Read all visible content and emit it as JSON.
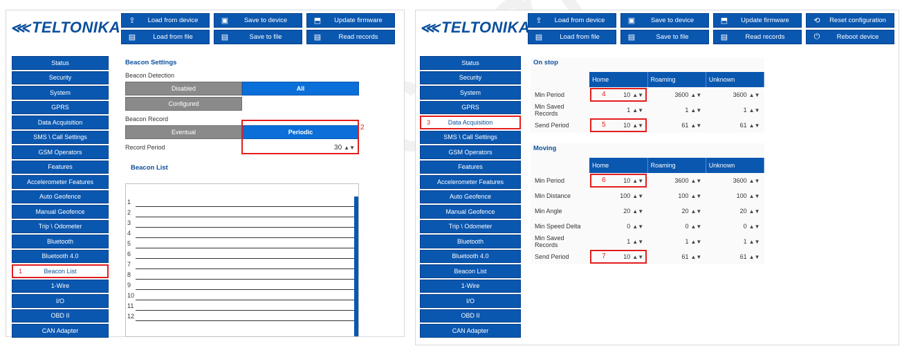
{
  "watermark": "430.com",
  "left": {
    "logo": "TELTONIKA",
    "toolbar": [
      {
        "label": "Load from device",
        "icon": "upload-icon"
      },
      {
        "label": "Save to device",
        "icon": "save-icon"
      },
      {
        "label": "Update firmware",
        "icon": "firmware-icon"
      },
      {
        "label": "Load from file",
        "icon": "file-icon"
      },
      {
        "label": "Save to file",
        "icon": "file-icon"
      },
      {
        "label": "Read records",
        "icon": "file-icon"
      }
    ],
    "sidebar": [
      "Status",
      "Security",
      "System",
      "GPRS",
      "Data Acquisition",
      "SMS \\ Call Settings",
      "GSM Operators",
      "Features",
      "Accelerometer Features",
      "Auto Geofence",
      "Manual Geofence",
      "Trip \\ Odometer",
      "Bluetooth",
      "Bluetooth 4.0",
      "Beacon List",
      "1-Wire",
      "I/O",
      "OBD II",
      "CAN Adapter"
    ],
    "active_item": "Beacon List",
    "active_number": "1",
    "beacon_settings": {
      "title": "Beacon Settings",
      "detection_label": "Beacon Detection",
      "opt_disabled": "Disabled",
      "opt_all": "All",
      "opt_configured": "Configured",
      "record_label": "Beacon Record",
      "opt_eventual": "Eventual",
      "opt_periodic": "Periodic",
      "period_label": "Record Period",
      "period_value": "30",
      "annotation": "2"
    },
    "beacon_list": {
      "title": "Beacon List",
      "rows": [
        "1",
        "2",
        "3",
        "4",
        "5",
        "6",
        "7",
        "8",
        "9",
        "10",
        "11",
        "12"
      ]
    }
  },
  "right": {
    "logo": "TELTONIKA",
    "toolbar": [
      {
        "label": "Load from device",
        "icon": "upload-icon"
      },
      {
        "label": "Save to device",
        "icon": "save-icon"
      },
      {
        "label": "Update firmware",
        "icon": "firmware-icon"
      },
      {
        "label": "Reset configuration",
        "icon": "reset-icon"
      },
      {
        "label": "Load from file",
        "icon": "file-icon"
      },
      {
        "label": "Save to file",
        "icon": "file-icon"
      },
      {
        "label": "Read records",
        "icon": "file-icon"
      },
      {
        "label": "Reboot device",
        "icon": "reboot-icon"
      }
    ],
    "sidebar": [
      "Status",
      "Security",
      "System",
      "GPRS",
      "Data Acquisition",
      "SMS \\ Call Settings",
      "GSM Operators",
      "Features",
      "Accelerometer Features",
      "Auto Geofence",
      "Manual Geofence",
      "Trip \\ Odometer",
      "Bluetooth",
      "Bluetooth 4.0",
      "Beacon List",
      "1-Wire",
      "I/O",
      "OBD II",
      "CAN Adapter"
    ],
    "active_item": "Data Acquisition",
    "active_number": "3",
    "columns": [
      "Home",
      "Roaming",
      "Unknown"
    ],
    "on_stop": {
      "title": "On stop",
      "rows": [
        {
          "name": "Min Period",
          "home": "10",
          "roaming": "3600",
          "unknown": "3600",
          "mark": "4"
        },
        {
          "name": "Min Saved Records",
          "home": "1",
          "roaming": "1",
          "unknown": "1",
          "mark": ""
        },
        {
          "name": "Send Period",
          "home": "10",
          "roaming": "61",
          "unknown": "61",
          "mark": "5"
        }
      ]
    },
    "moving": {
      "title": "Moving",
      "rows": [
        {
          "name": "Min Period",
          "home": "10",
          "roaming": "3600",
          "unknown": "3600",
          "mark": "6"
        },
        {
          "name": "Min Distance",
          "home": "100",
          "roaming": "100",
          "unknown": "100",
          "mark": ""
        },
        {
          "name": "Min Angle",
          "home": "20",
          "roaming": "20",
          "unknown": "20",
          "mark": ""
        },
        {
          "name": "Min Speed Delta",
          "home": "0",
          "roaming": "0",
          "unknown": "0",
          "mark": ""
        },
        {
          "name": "Min Saved Records",
          "home": "1",
          "roaming": "1",
          "unknown": "1",
          "mark": ""
        },
        {
          "name": "Send Period",
          "home": "10",
          "roaming": "61",
          "unknown": "61",
          "mark": "7"
        }
      ]
    }
  },
  "colors": {
    "brand_blue": "#0a57b0",
    "highlight_red": "#e31d1d",
    "disabled_gray": "#8a8a8a"
  }
}
